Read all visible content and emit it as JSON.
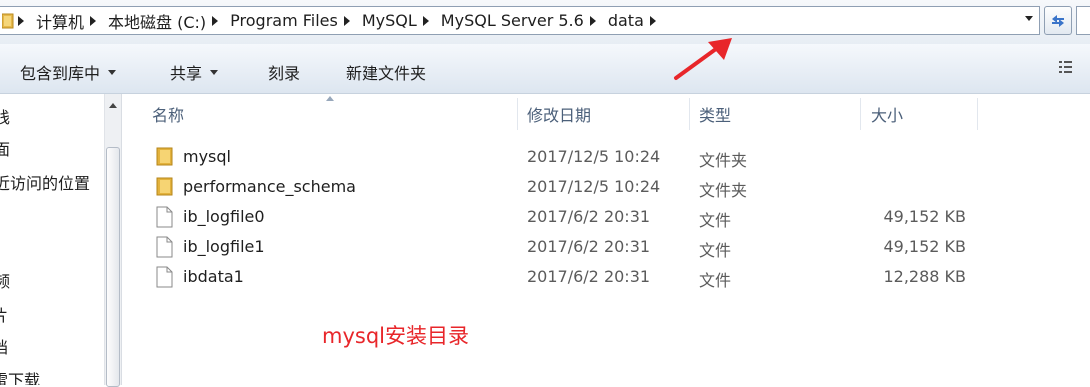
{
  "address_bar": {
    "crumbs": [
      "计算机",
      "本地磁盘 (C:)",
      "Program Files",
      "MySQL",
      "MySQL Server 5.6",
      "data"
    ]
  },
  "toolbar": {
    "items": [
      {
        "label": "包含到库中",
        "has_dropdown": true
      },
      {
        "label": "共享",
        "has_dropdown": true
      },
      {
        "label": "刻录",
        "has_dropdown": false
      },
      {
        "label": "新建文件夹",
        "has_dropdown": false
      }
    ]
  },
  "nav_pane": {
    "items": [
      "栈",
      "面",
      "近访问的位置",
      "频",
      "片",
      "档",
      "雷下载"
    ]
  },
  "columns": {
    "name": "名称",
    "date": "修改日期",
    "type": "类型",
    "size": "大小"
  },
  "files": [
    {
      "name": "mysql",
      "date": "2017/12/5 10:24",
      "type": "文件夹",
      "size": "",
      "icon": "folder-icon"
    },
    {
      "name": "performance_schema",
      "date": "2017/12/5 10:24",
      "type": "文件夹",
      "size": "",
      "icon": "folder-icon"
    },
    {
      "name": "ib_logfile0",
      "date": "2017/6/2 20:31",
      "type": "文件",
      "size": "49,152 KB",
      "icon": "file-icon"
    },
    {
      "name": "ib_logfile1",
      "date": "2017/6/2 20:31",
      "type": "文件",
      "size": "49,152 KB",
      "icon": "file-icon"
    },
    {
      "name": "ibdata1",
      "date": "2017/6/2 20:31",
      "type": "文件",
      "size": "12,288 KB",
      "icon": "file-icon"
    }
  ],
  "annotation": {
    "text": "mysql安装目录",
    "color": "#e8262a"
  }
}
